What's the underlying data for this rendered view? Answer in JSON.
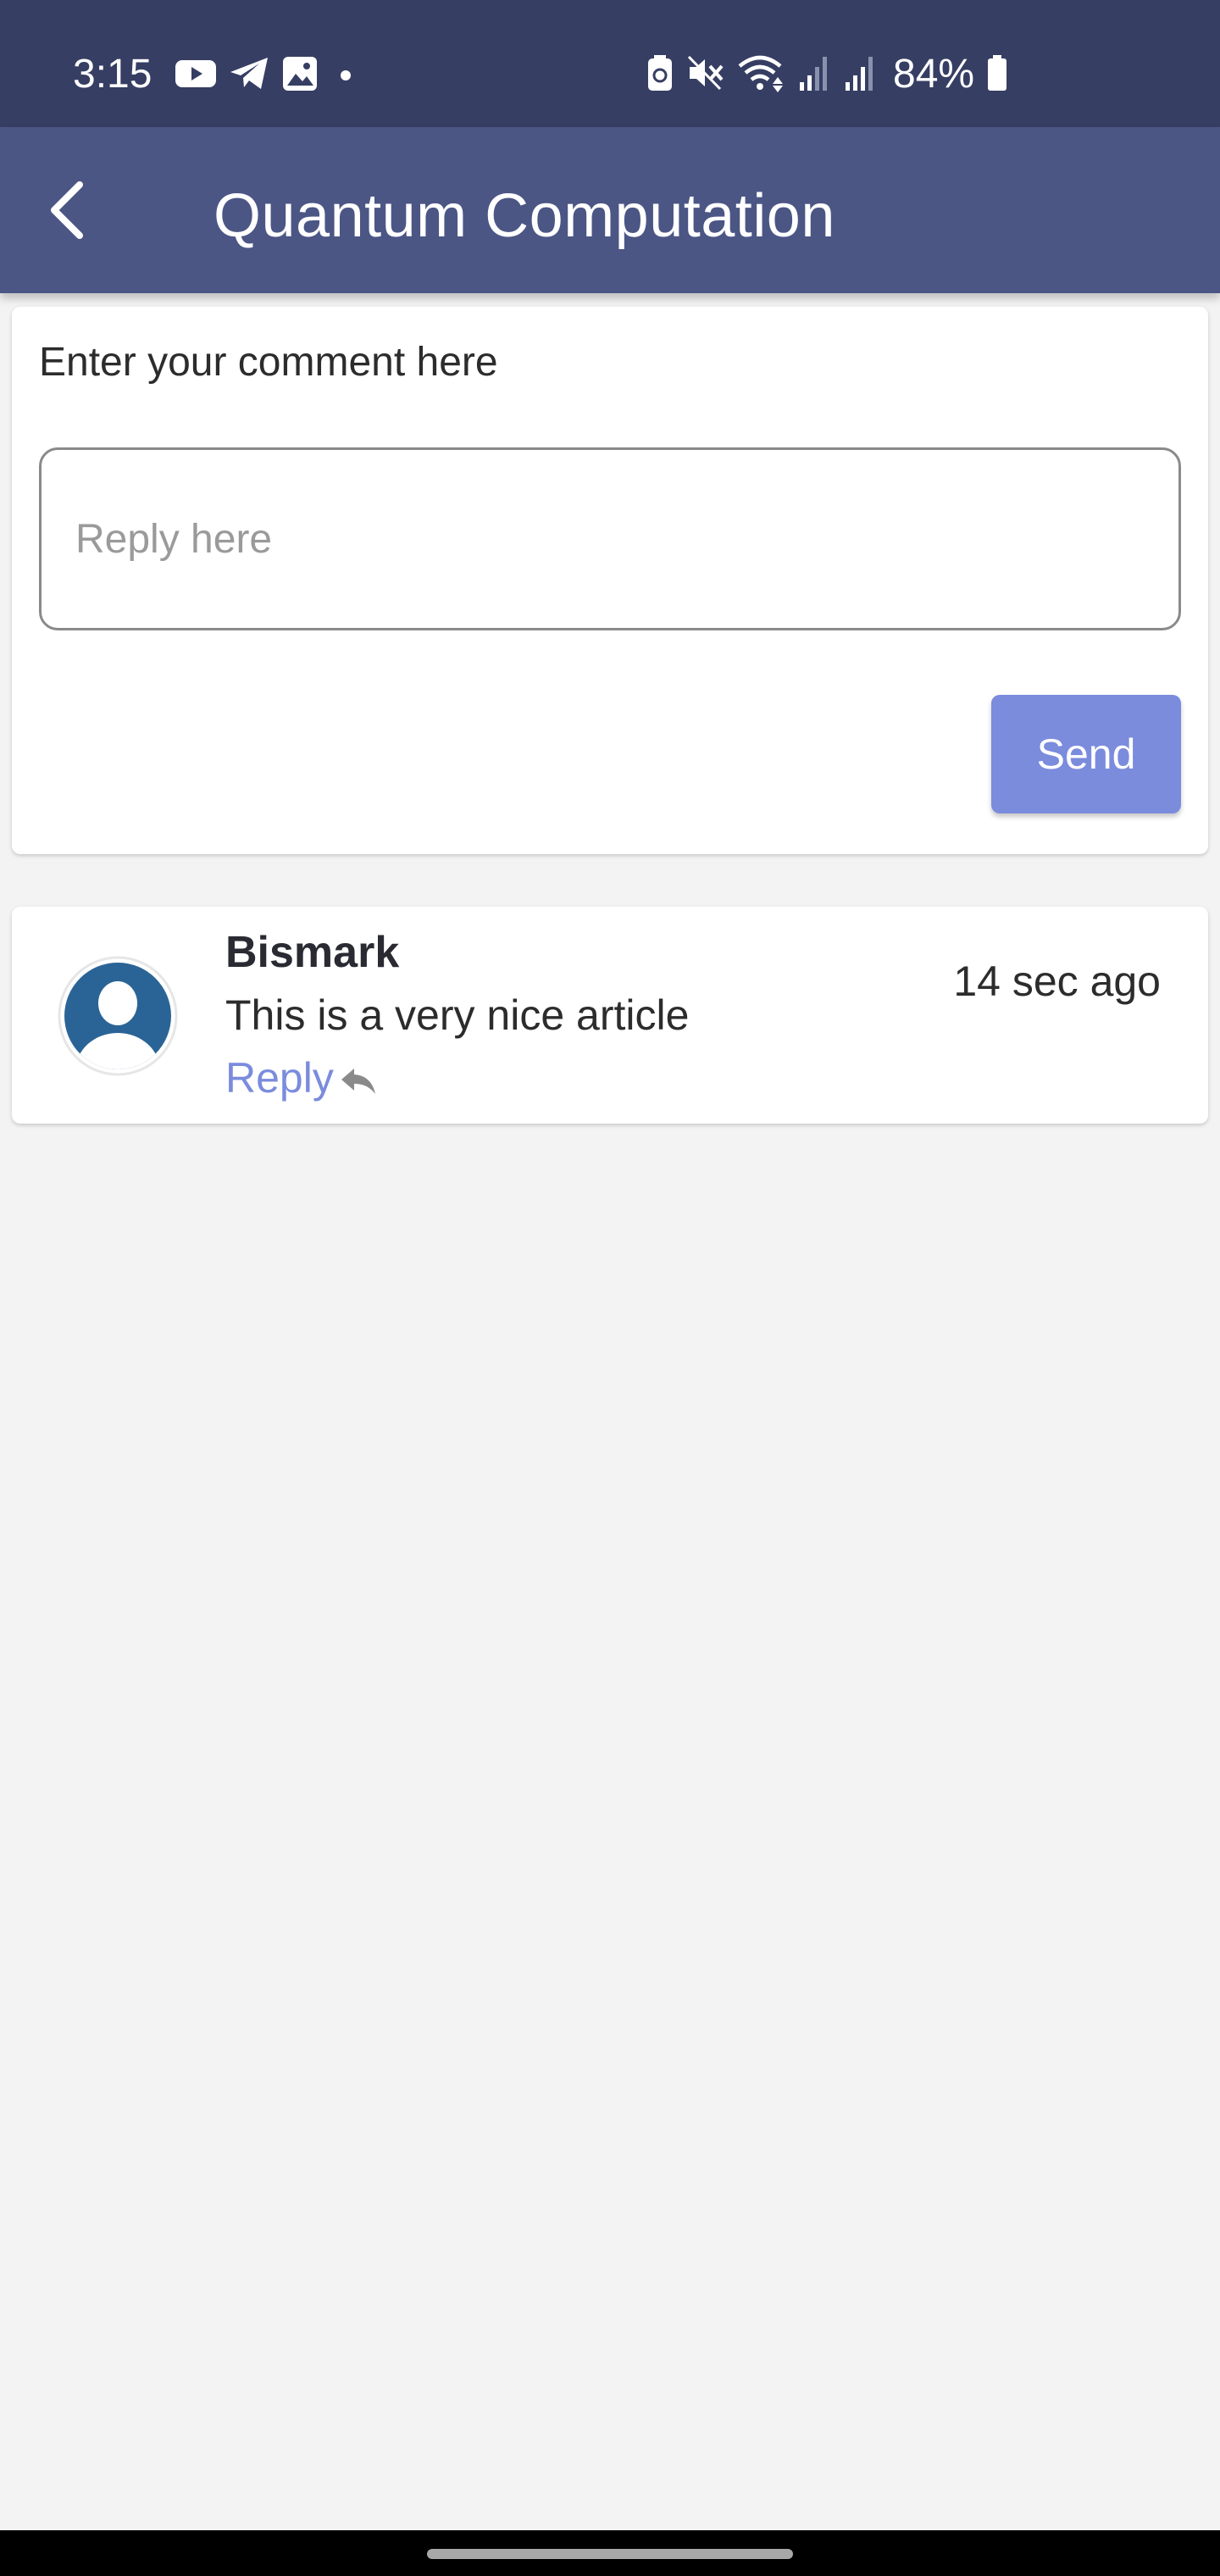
{
  "status_bar": {
    "time": "3:15",
    "battery": "84%",
    "left_icons": [
      "youtube-icon",
      "telegram-icon",
      "gallery-icon",
      "dot-icon"
    ],
    "right_icons": [
      "battery-saver-icon",
      "mute-icon",
      "wifi-icon",
      "signal-icon",
      "signal-icon",
      "battery-icon"
    ]
  },
  "app_bar": {
    "title": "Quantum Computation",
    "back_icon": "chevron-left-icon"
  },
  "comment_form": {
    "label": "Enter your comment here",
    "placeholder": "Reply here",
    "value": "",
    "send_label": "Send"
  },
  "comments": [
    {
      "author": "Bismark",
      "text": "This is a very nice article",
      "time": "14 sec ago",
      "reply_label": "Reply",
      "avatar_icon": "user-avatar-icon",
      "reply_icon": "reply-arrow-icon"
    }
  ],
  "colors": {
    "status_bar": "#363e63",
    "app_bar": "#4b5685",
    "accent": "#7b8cdd",
    "avatar": "#2a6496",
    "background": "#f3f3f3"
  }
}
